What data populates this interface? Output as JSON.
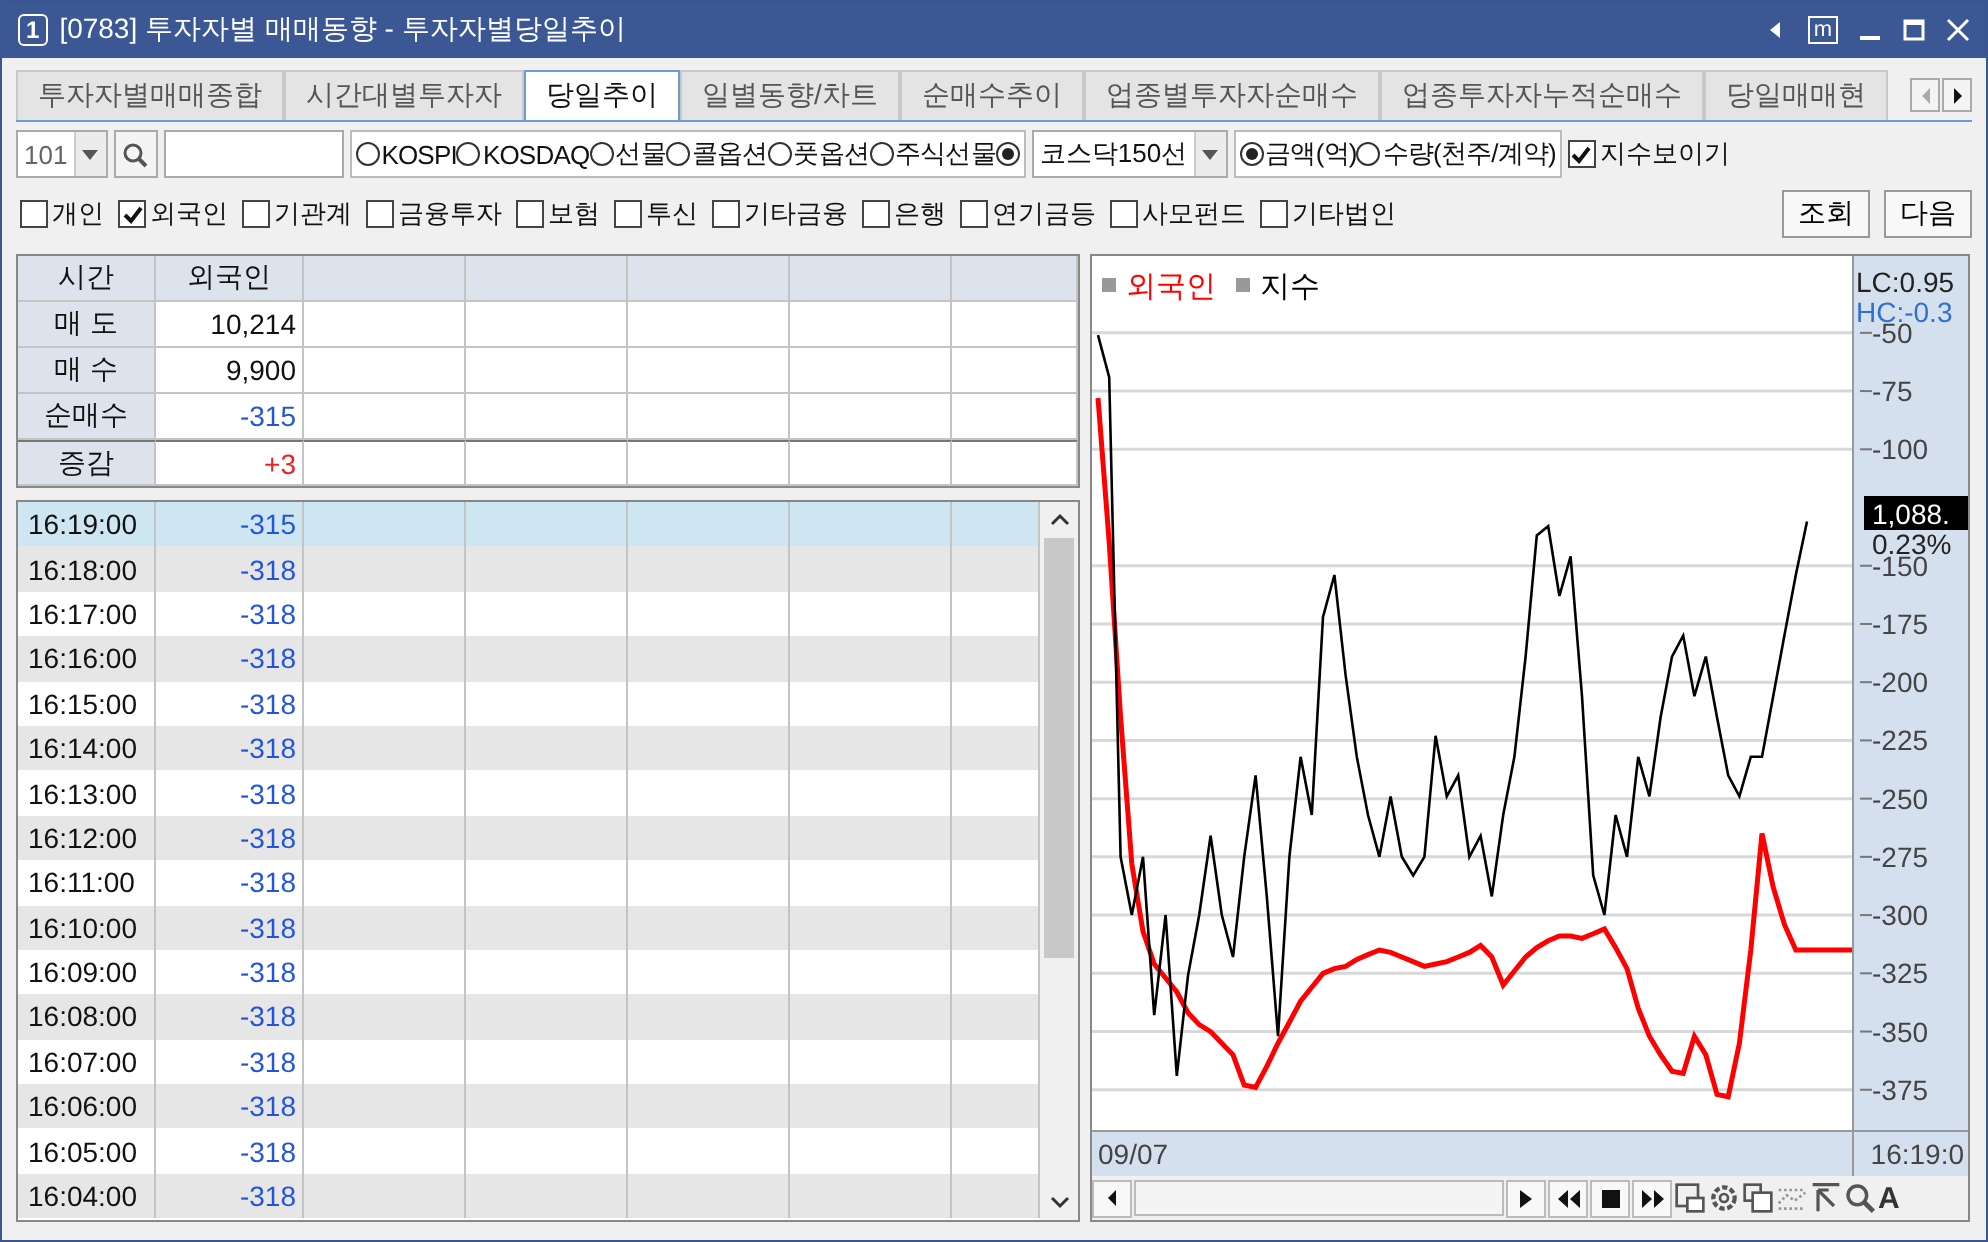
{
  "window": {
    "number_badge": "1",
    "title": "[0783]  투자자별 매매동향 - 투자자별당일추이",
    "menu_badge": "m"
  },
  "tabs": [
    {
      "label": "투자자별매매종합",
      "selected": false
    },
    {
      "label": "시간대별투자자",
      "selected": false
    },
    {
      "label": "당일추이",
      "selected": true
    },
    {
      "label": "일별동향/차트",
      "selected": false
    },
    {
      "label": "순매수추이",
      "selected": false
    },
    {
      "label": "업종별투자자순매수",
      "selected": false
    },
    {
      "label": "업종투자자누적순매수",
      "selected": false
    },
    {
      "label": "당일매매현",
      "selected": false
    }
  ],
  "toolbar": {
    "code_combo": "101",
    "market_radios": [
      {
        "label": "KOSPI",
        "selected": false
      },
      {
        "label": "KOSDAQ",
        "selected": false
      },
      {
        "label": "선물",
        "selected": false
      },
      {
        "label": "콜옵션",
        "selected": false
      },
      {
        "label": "풋옵션",
        "selected": false
      },
      {
        "label": "주식선물",
        "selected": false
      },
      {
        "selected": true
      }
    ],
    "sector_combo": "코스닥150선",
    "unit_radios": [
      {
        "label": "금액(억)",
        "selected": true
      },
      {
        "label": "수량(천주/계약)",
        "selected": false
      }
    ],
    "show_index": {
      "label": "지수보이기",
      "checked": true
    }
  },
  "investors": [
    {
      "label": "개인",
      "checked": false
    },
    {
      "label": "외국인",
      "checked": true
    },
    {
      "label": "기관계",
      "checked": false
    },
    {
      "label": "금융투자",
      "checked": false
    },
    {
      "label": "보험",
      "checked": false
    },
    {
      "label": "투신",
      "checked": false
    },
    {
      "label": "기타금융",
      "checked": false
    },
    {
      "label": "은행",
      "checked": false
    },
    {
      "label": "연기금등",
      "checked": false
    },
    {
      "label": "사모펀드",
      "checked": false
    },
    {
      "label": "기타법인",
      "checked": false
    }
  ],
  "buttons": [
    "조회",
    "다음"
  ],
  "summary_table": {
    "columns": [
      "시간",
      "외국인"
    ],
    "rows": [
      {
        "label": "매 도",
        "value": "10,214",
        "color": "#111111"
      },
      {
        "label": "매 수",
        "value": "9,900",
        "color": "#111111"
      },
      {
        "label": "순매수",
        "value": "-315",
        "color": "#2255dd"
      },
      {
        "label": "증감",
        "value": "+3",
        "color": "#ee2222"
      }
    ]
  },
  "time_rows": [
    {
      "time": "16:19:00",
      "value": "-315",
      "selected": true
    },
    {
      "time": "16:18:00",
      "value": "-318",
      "selected": false
    },
    {
      "time": "16:17:00",
      "value": "-318",
      "selected": false
    },
    {
      "time": "16:16:00",
      "value": "-318",
      "selected": false
    },
    {
      "time": "16:15:00",
      "value": "-318",
      "selected": false
    },
    {
      "time": "16:14:00",
      "value": "-318",
      "selected": false
    },
    {
      "time": "16:13:00",
      "value": "-318",
      "selected": false
    },
    {
      "time": "16:12:00",
      "value": "-318",
      "selected": false
    },
    {
      "time": "16:11:00",
      "value": "-318",
      "selected": false
    },
    {
      "time": "16:10:00",
      "value": "-318",
      "selected": false
    },
    {
      "time": "16:09:00",
      "value": "-318",
      "selected": false
    },
    {
      "time": "16:08:00",
      "value": "-318",
      "selected": false
    },
    {
      "time": "16:07:00",
      "value": "-318",
      "selected": false
    },
    {
      "time": "16:06:00",
      "value": "-318",
      "selected": false
    },
    {
      "time": "16:05:00",
      "value": "-318",
      "selected": false
    },
    {
      "time": "16:04:00",
      "value": "-318",
      "selected": false
    }
  ],
  "chart": {
    "lc": "LC:0.95",
    "hc": "HC:-0.3",
    "index_price": "1,088.",
    "index_change": "0.23%",
    "start_date": "09/07",
    "end_time": "16:19:0",
    "text_tool": "A",
    "chart_data": {
      "type": "line",
      "grid": true,
      "ylim": [
        -394,
        -17
      ],
      "yticks": [
        -50,
        -75,
        -100,
        -150,
        -175,
        -200,
        -225,
        -250,
        -275,
        -300,
        -325,
        -350,
        -375
      ],
      "series": [
        {
          "name": "외국인",
          "color": "#ff0000",
          "values": [
            -78,
            -140,
            -215,
            -278,
            -307,
            -321,
            -327,
            -333,
            -342,
            -347,
            -350,
            -355,
            -360,
            -373,
            -374,
            -365,
            -355,
            -346,
            -337,
            -331,
            -325,
            -323,
            -322,
            -319,
            -317,
            -315,
            -316,
            -318,
            -320,
            -322,
            -321,
            -320,
            -318,
            -316,
            -313,
            -318,
            -330,
            -324,
            -318,
            -314,
            -311,
            -309,
            -309,
            -310,
            -308,
            -306,
            -314,
            -323,
            -340,
            -352,
            -360,
            -367,
            -368,
            -352,
            -360,
            -377,
            -378,
            -355,
            -315,
            -265,
            -288,
            -304,
            -315,
            -315,
            -315,
            -315,
            -315,
            -315
          ]
        },
        {
          "name": "지수",
          "color": "#000000",
          "values": [
            -51,
            -69,
            -275,
            -300,
            -275,
            -343,
            -300,
            -369,
            -326,
            -300,
            -266,
            -300,
            -318,
            -275,
            -240,
            -292,
            -352,
            -275,
            -232,
            -257,
            -172,
            -154,
            -197,
            -232,
            -257,
            -275,
            -249,
            -275,
            -283,
            -275,
            -223,
            -249,
            -240,
            -275,
            -266,
            -292,
            -257,
            -232,
            -189,
            -137,
            -133,
            -163,
            -146,
            -206,
            -283,
            -300,
            -257,
            -275,
            -232,
            -249,
            -215,
            -189,
            -180,
            -206,
            -189,
            -215,
            -240,
            -249,
            -232,
            -232,
            -206,
            -180,
            -154,
            -131,
            null,
            null,
            null,
            null
          ]
        }
      ]
    }
  }
}
